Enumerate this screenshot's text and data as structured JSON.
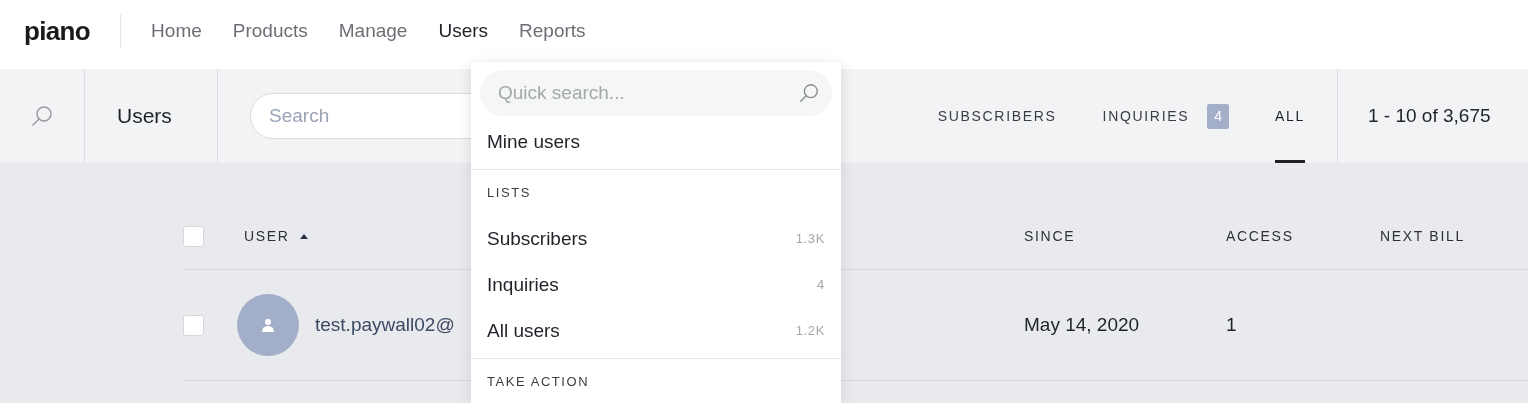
{
  "logo": "piano",
  "nav": [
    {
      "label": "Home",
      "selected": false
    },
    {
      "label": "Products",
      "selected": false
    },
    {
      "label": "Manage",
      "selected": false
    },
    {
      "label": "Users",
      "selected": true
    },
    {
      "label": "Reports",
      "selected": false
    }
  ],
  "toolbar": {
    "title": "Users",
    "search": {
      "placeholder": "Search"
    },
    "tabs": [
      {
        "label": "SUBSCRIBERS",
        "selected": false
      },
      {
        "label": "INQUIRIES",
        "badge": "4",
        "selected": false
      },
      {
        "label": "ALL",
        "selected": true
      }
    ],
    "pagination": "1 - 10 of 3,675"
  },
  "table": {
    "select_all": {
      "checked": false
    },
    "columns": [
      {
        "label": "USER",
        "sorted": true
      },
      {
        "label": "SINCE",
        "sorted": false
      },
      {
        "label": "ACCESS",
        "sorted": false
      },
      {
        "label": "NEXT BILL",
        "sorted": false
      }
    ],
    "rows": [
      {
        "checked": false,
        "user": "test.paywall02@",
        "since": "May 14, 2020",
        "access": "1"
      }
    ]
  },
  "dropdown": {
    "search": {
      "placeholder": "Quick search..."
    },
    "top_item": "Mine users",
    "sections": [
      {
        "heading": "LISTS",
        "items": [
          {
            "label": "Subscribers",
            "count": "1.3K"
          },
          {
            "label": "Inquiries",
            "count": "4"
          },
          {
            "label": "All users",
            "count": "1.2K"
          }
        ]
      },
      {
        "heading": "TAKE ACTION"
      }
    ]
  }
}
